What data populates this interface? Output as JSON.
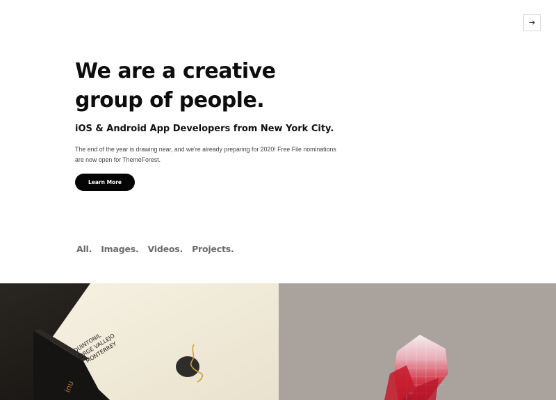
{
  "header": {
    "next_icon": "arrow-right-icon"
  },
  "hero": {
    "headline_line1": "We are a creative",
    "headline_line2": "group of people.",
    "subtitle": "iOS & Android App Developers from New York City.",
    "body": "The end of the year is drawing near, and we're already preparing for 2020! Free File nominations are now open for ThemeForest.",
    "cta_label": "Learn More"
  },
  "filters": [
    {
      "label": "All."
    },
    {
      "label": "Images."
    },
    {
      "label": "Videos."
    },
    {
      "label": "Projects."
    }
  ],
  "portfolio": {
    "card_text_line1": "QUINTONIL",
    "card_text_line2": "JORGE VALLEJO",
    "card_text_line3": "MONTERREY"
  },
  "colors": {
    "cta_background": "#050505",
    "filter_text": "#6b6b6b",
    "left_tile_background": "#1b1916",
    "right_tile_background": "#aaa39d"
  }
}
